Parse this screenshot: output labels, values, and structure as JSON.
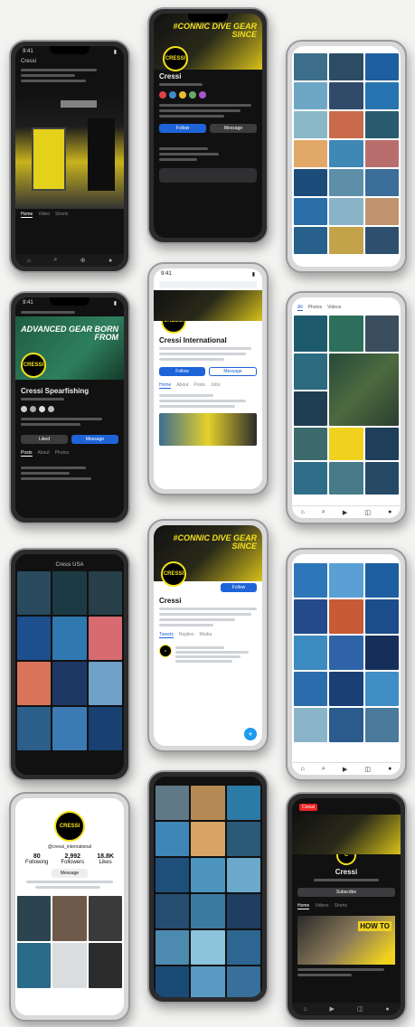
{
  "p1": {
    "title": "Cressi",
    "tabs": [
      "Home",
      "Video",
      "Shorts"
    ]
  },
  "p2": {
    "name": "Cressi",
    "banner": "#CONNIC DIVE GEAR SINCE",
    "follow": "Follow",
    "message": "Message"
  },
  "p4": {
    "name": "Cressi Spearfishing",
    "banner": "ADVANCED GEAR BORN FROM",
    "btn1": "Liked",
    "btn2": "Message"
  },
  "p5": {
    "name": "Cressi International",
    "follow": "Follow",
    "message": "Message"
  },
  "p7": {
    "title": "Cressi USA"
  },
  "p8": {
    "name": "Cressi",
    "banner": "#CONNIC DIVE GEAR SINCE",
    "follow": "Follow"
  },
  "p10": {
    "handle": "@cressi_international",
    "stats": [
      {
        "n": "80",
        "l": "Following"
      },
      {
        "n": "2,992",
        "l": "Followers"
      },
      {
        "n": "18.8K",
        "l": "Likes"
      }
    ],
    "follow": "Message"
  },
  "p12": {
    "name": "Cressi",
    "badge": "Cressi",
    "subscribe": "Subscribe",
    "banner": "HOW TO"
  }
}
